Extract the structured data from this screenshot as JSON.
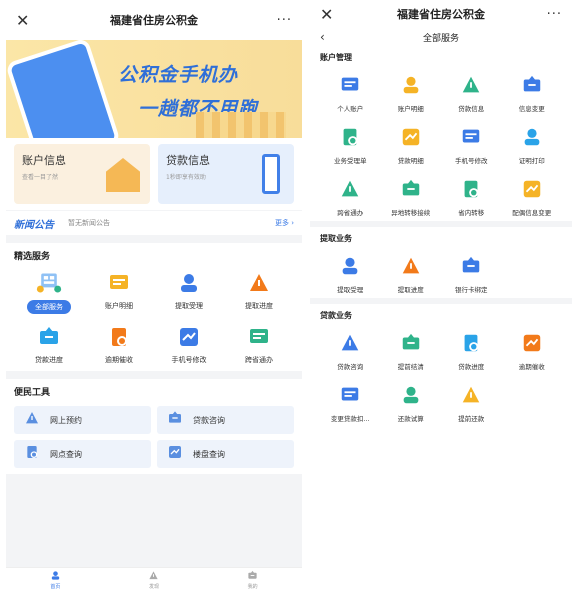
{
  "left": {
    "titlebar": {
      "close": "✕",
      "title": "福建省住房公积金",
      "more": "···"
    },
    "banner": {
      "line1": "公积金手机办",
      "line2": "一趟都不用跑"
    },
    "cards": [
      {
        "title": "账户信息",
        "subtitle": "查看一目了然"
      },
      {
        "title": "贷款信息",
        "subtitle": "1秒即享有效助"
      }
    ],
    "notice": {
      "logo": "新闻公告",
      "text": "暂无新闻公告",
      "more": "更多 ›"
    },
    "featured": {
      "title": "精选服务",
      "all_label": "全部服务",
      "items": [
        {
          "label": "账户明细",
          "icon": "account-detail-icon",
          "color": "#f5b326"
        },
        {
          "label": "提取受理",
          "icon": "withdraw-accept-icon",
          "color": "#3c7be6"
        },
        {
          "label": "提取进度",
          "icon": "withdraw-progress-icon",
          "color": "#f27a1a"
        },
        {
          "label": "贷款进度",
          "icon": "loan-progress-icon",
          "color": "#2aa3e8"
        },
        {
          "label": "逾期催收",
          "icon": "overdue-collection-icon",
          "color": "#f27a1a"
        },
        {
          "label": "手机号修改",
          "icon": "phone-change-icon",
          "color": "#3c7be6"
        },
        {
          "label": "跨省通办",
          "icon": "cross-province-icon",
          "color": "#2fb38a"
        }
      ]
    },
    "tools": {
      "title": "便民工具",
      "items": [
        {
          "label": "网上预约",
          "icon": "house-icon"
        },
        {
          "label": "贷款咨询",
          "icon": "chat-icon"
        },
        {
          "label": "网点查询",
          "icon": "location-icon"
        },
        {
          "label": "楼盘查询",
          "icon": "building-icon"
        }
      ]
    },
    "tabs": [
      {
        "label": "首页",
        "icon": "home-icon"
      },
      {
        "label": "发现",
        "icon": "discover-icon"
      },
      {
        "label": "我的",
        "icon": "profile-icon"
      }
    ]
  },
  "right": {
    "titlebar": {
      "close": "✕",
      "title": "福建省住房公积金",
      "more": "···"
    },
    "subheader": {
      "back": "‹",
      "title": "全部服务"
    },
    "sections": [
      {
        "title": "账户管理",
        "items": [
          {
            "label": "个人账户",
            "icon": "person-icon",
            "color": "#3c7be6"
          },
          {
            "label": "账户明细",
            "icon": "account-detail-icon",
            "color": "#f5b326"
          },
          {
            "label": "贷款信息",
            "icon": "loan-info-icon",
            "color": "#2fb38a"
          },
          {
            "label": "信息变更",
            "icon": "info-change-icon",
            "color": "#3c7be6"
          },
          {
            "label": "业务受理单",
            "icon": "business-form-icon",
            "color": "#2fb38a"
          },
          {
            "label": "贷款明细",
            "icon": "loan-detail-icon",
            "color": "#f5b326"
          },
          {
            "label": "手机号修改",
            "icon": "phone-change-icon",
            "color": "#3c7be6"
          },
          {
            "label": "证明打印",
            "icon": "print-icon",
            "color": "#2aa3e8"
          },
          {
            "label": "跨省通办",
            "icon": "cross-province-icon",
            "color": "#2fb38a"
          },
          {
            "label": "异地转移接续",
            "icon": "transfer-icon",
            "color": "#2fb38a"
          },
          {
            "label": "省内转移",
            "icon": "province-transfer-icon",
            "color": "#2fb38a"
          },
          {
            "label": "配偶信息变更",
            "icon": "spouse-info-icon",
            "color": "#f5b326"
          }
        ]
      },
      {
        "title": "提取业务",
        "items": [
          {
            "label": "提取受理",
            "icon": "withdraw-accept-icon",
            "color": "#3c7be6"
          },
          {
            "label": "提取进度",
            "icon": "withdraw-progress-icon",
            "color": "#f27a1a"
          },
          {
            "label": "银行卡绑定",
            "icon": "bank-card-icon",
            "color": "#3c7be6"
          }
        ]
      },
      {
        "title": "贷款业务",
        "items": [
          {
            "label": "贷款咨询",
            "icon": "loan-consult-icon",
            "color": "#3c7be6"
          },
          {
            "label": "提前结清",
            "icon": "early-settle-icon",
            "color": "#2fb38a"
          },
          {
            "label": "贷款进度",
            "icon": "loan-progress-icon",
            "color": "#2aa3e8"
          },
          {
            "label": "逾期催收",
            "icon": "overdue-collection-icon",
            "color": "#f27a1a"
          },
          {
            "label": "变更贷款扣...",
            "icon": "change-deduct-icon",
            "color": "#3c7be6"
          },
          {
            "label": "还款试算",
            "icon": "repay-calc-icon",
            "color": "#2fb38a"
          },
          {
            "label": "提前还款",
            "icon": "early-repay-icon",
            "color": "#f5b326"
          }
        ]
      }
    ]
  }
}
